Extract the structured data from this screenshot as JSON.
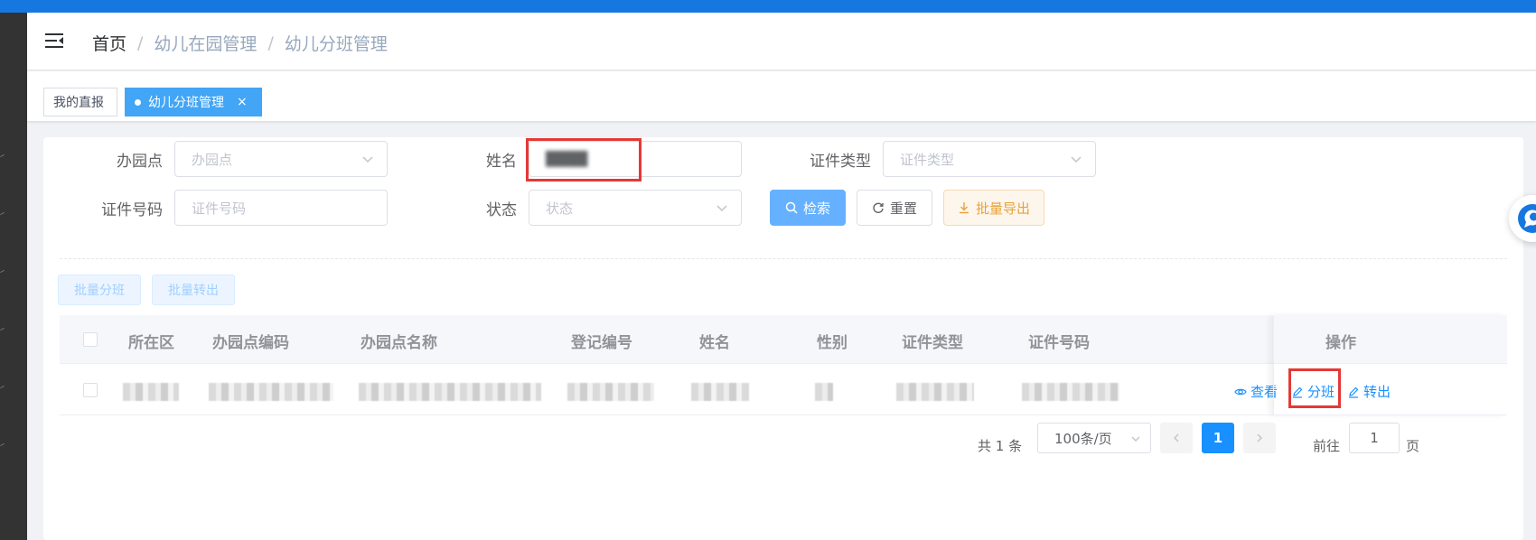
{
  "breadcrumb": {
    "home": "首页",
    "sep": "/",
    "level1": "幼儿在园管理",
    "level2": "幼儿分班管理"
  },
  "tags": {
    "plain": "我的直报",
    "active": "幼儿分班管理",
    "close": "×"
  },
  "filters": {
    "campus": {
      "label": "办园点",
      "placeholder": "办园点"
    },
    "name": {
      "label": "姓名",
      "value": "████"
    },
    "id_type": {
      "label": "证件类型",
      "placeholder": "证件类型"
    },
    "id_number": {
      "label": "证件号码",
      "placeholder": "证件号码"
    },
    "status": {
      "label": "状态",
      "placeholder": "状态"
    }
  },
  "buttons": {
    "search": "检索",
    "reset": "重置",
    "export": "批量导出",
    "batch_assign": "批量分班",
    "batch_transfer": "批量转出"
  },
  "table": {
    "columns": [
      "所在区",
      "办园点编码",
      "办园点名称",
      "登记编号",
      "姓名",
      "性别",
      "证件类型",
      "证件号码",
      "操作"
    ],
    "row_actions": {
      "view": "查看",
      "assign": "分班",
      "transfer": "转出"
    }
  },
  "pagination": {
    "total": "共 1 条",
    "page_size": "100条/页",
    "current": "1",
    "goto_prefix": "前往",
    "goto_value": "1",
    "goto_suffix": "页"
  },
  "colors": {
    "topbar": "#1677e0",
    "primary": "#1890ff",
    "tag_active": "#42a5f5",
    "warning": "#e6a23c",
    "highlight": "#e53935"
  }
}
